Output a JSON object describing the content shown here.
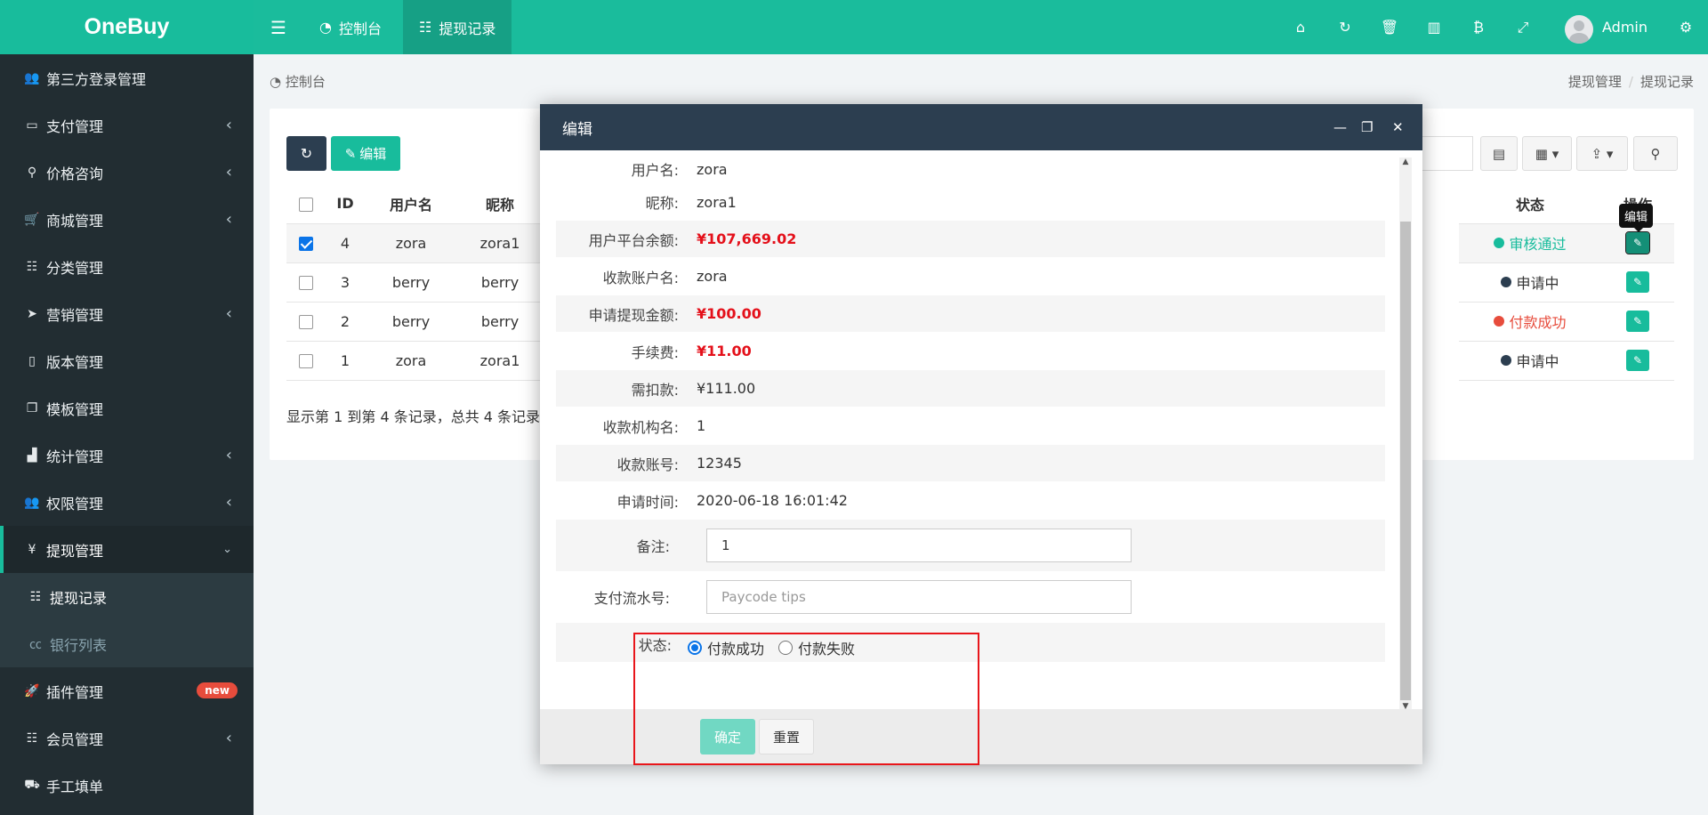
{
  "app": {
    "logo": "OneBuy"
  },
  "header": {
    "menu_icon": "hamburger-icon",
    "tabs": [
      {
        "label": "控制台",
        "icon": "dashboard-icon"
      },
      {
        "label": "提现记录",
        "icon": "list-icon"
      }
    ],
    "tools": [
      "home-icon",
      "refresh-icon",
      "trash-icon",
      "translate-icon",
      "bitcoin-icon",
      "fullscreen-icon"
    ],
    "user": "Admin",
    "settings_icon": "gears-icon"
  },
  "sidebar": {
    "items": [
      {
        "label": "第三方登录管理",
        "icon": "users-icon"
      },
      {
        "label": "支付管理",
        "icon": "card-icon"
      },
      {
        "label": "价格咨询",
        "icon": "search-icon"
      },
      {
        "label": "商城管理",
        "icon": "cart-icon"
      },
      {
        "label": "分类管理",
        "icon": "list-icon"
      },
      {
        "label": "营销管理",
        "icon": "send-icon"
      },
      {
        "label": "版本管理",
        "icon": "file-icon"
      },
      {
        "label": "模板管理",
        "icon": "clone-icon"
      },
      {
        "label": "统计管理",
        "icon": "bar-chart-icon"
      },
      {
        "label": "权限管理",
        "icon": "group-icon"
      },
      {
        "label": "提现管理",
        "icon": "yen-icon"
      },
      {
        "label": "提现记录",
        "icon": "list-icon"
      },
      {
        "label": "银行列表",
        "icon": "cc-icon"
      },
      {
        "label": "插件管理",
        "icon": "rocket-icon",
        "badge": "new"
      },
      {
        "label": "会员管理",
        "icon": "list-icon"
      },
      {
        "label": "手工填单",
        "icon": "truck-icon"
      }
    ]
  },
  "breadcrumb": {
    "left": "控制台",
    "right_1": "提现管理",
    "right_2": "提现记录"
  },
  "toolbar": {
    "edit_label": "编辑"
  },
  "table": {
    "headers": {
      "id": "ID",
      "username": "用户名",
      "nickname": "昵称",
      "status": "状态",
      "action": "操作"
    },
    "rows": [
      {
        "id": "4",
        "username": "zora",
        "nickname": "zora1",
        "status": "审核通过",
        "status_color": "#18bc9c",
        "checked": true
      },
      {
        "id": "3",
        "username": "berry",
        "nickname": "berry",
        "status": "申请中",
        "status_color": "#2c3e50",
        "checked": false
      },
      {
        "id": "2",
        "username": "berry",
        "nickname": "berry",
        "status": "付款成功",
        "status_color": "#e74c3c",
        "checked": false
      },
      {
        "id": "1",
        "username": "zora",
        "nickname": "zora1",
        "status": "申请中",
        "status_color": "#2c3e50",
        "checked": false
      }
    ],
    "tooltip": "编辑",
    "footer": "显示第 1 到第 4 条记录，总共 4 条记录"
  },
  "modal": {
    "title": "编辑",
    "fields": [
      {
        "label": "用户名:",
        "value": "zora"
      },
      {
        "label": "昵称:",
        "value": "zora1"
      },
      {
        "label": "用户平台余额:",
        "value": "¥107,669.02"
      },
      {
        "label": "收款账户名:",
        "value": "zora"
      },
      {
        "label": "申请提现金额:",
        "value": "¥100.00"
      },
      {
        "label": "手续费:",
        "value": "¥11.00"
      },
      {
        "label": "需扣款:",
        "value": "¥111.00"
      },
      {
        "label": "收款机构名:",
        "value": "1"
      },
      {
        "label": "收款账号:",
        "value": "12345"
      },
      {
        "label": "申请时间:",
        "value": "2020-06-18 16:01:42"
      }
    ],
    "remark": {
      "label": "备注:",
      "value": "1"
    },
    "paycode": {
      "label": "支付流水号:",
      "placeholder": "Paycode tips"
    },
    "status": {
      "label": "状态:",
      "option_success": "付款成功",
      "option_fail": "付款失败",
      "selected": "付款成功"
    },
    "confirm_label": "确定",
    "reset_label": "重置"
  }
}
